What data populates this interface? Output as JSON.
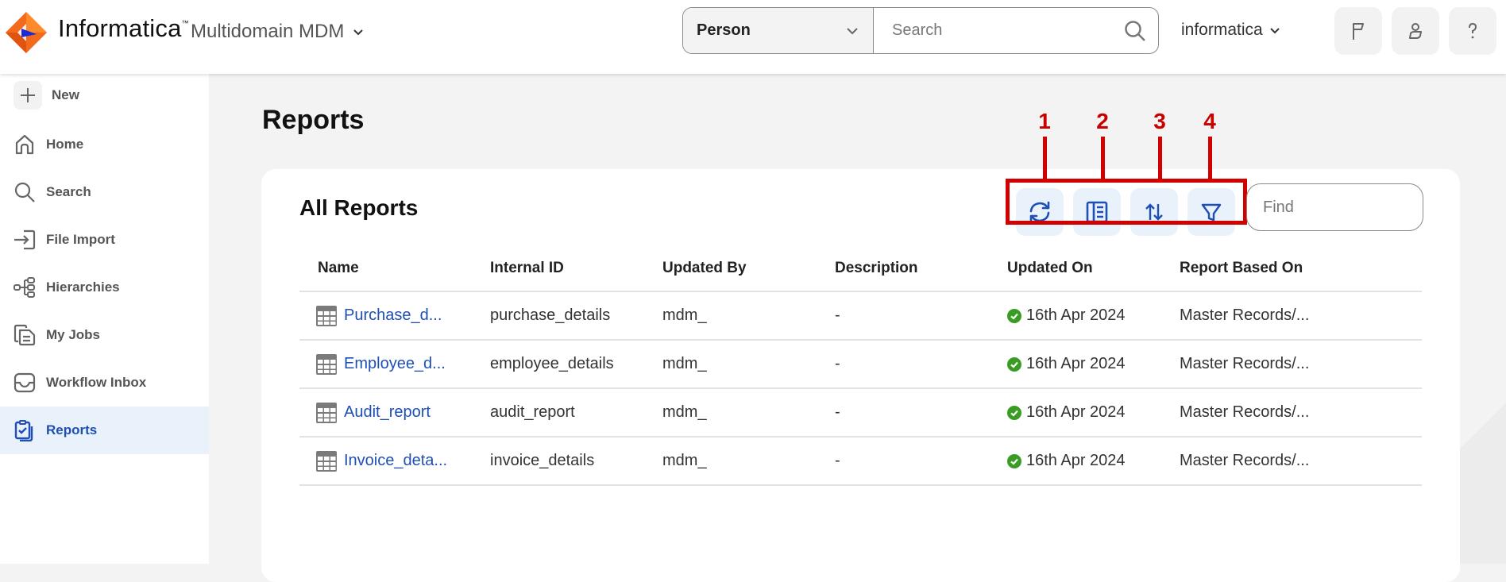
{
  "header": {
    "brand": "Informatica",
    "product": "Multidomain MDM",
    "entity_select": "Person",
    "search_placeholder": "Search",
    "user": "informatica",
    "icons": [
      "flag-icon",
      "user-icon",
      "help-icon"
    ]
  },
  "sidebar": {
    "new_label": "New",
    "items": [
      {
        "label": "Home",
        "icon": "home-icon",
        "active": false
      },
      {
        "label": "Search",
        "icon": "search-icon",
        "active": false
      },
      {
        "label": "File Import",
        "icon": "file-import-icon",
        "active": false
      },
      {
        "label": "Hierarchies",
        "icon": "hierarchies-icon",
        "active": false
      },
      {
        "label": "My Jobs",
        "icon": "jobs-icon",
        "active": false
      },
      {
        "label": "Workflow Inbox",
        "icon": "inbox-icon",
        "active": false
      },
      {
        "label": "Reports",
        "icon": "reports-icon",
        "active": true
      }
    ]
  },
  "main": {
    "page_title": "Reports",
    "card_title": "All Reports",
    "toolbar": {
      "buttons": [
        {
          "icon": "refresh-icon",
          "annotation": "1"
        },
        {
          "icon": "columns-icon",
          "annotation": "2"
        },
        {
          "icon": "sort-icon",
          "annotation": "3"
        },
        {
          "icon": "filter-icon",
          "annotation": "4"
        }
      ],
      "find_placeholder": "Find"
    },
    "table": {
      "columns": [
        "Name",
        "Internal ID",
        "Updated By",
        "Description",
        "Updated On",
        "Report Based On"
      ],
      "rows": [
        {
          "name": "Purchase_d...",
          "internal_id": "purchase_details",
          "updated_by": "mdm_",
          "description": "-",
          "updated_on": "16th Apr 2024",
          "based_on": "Master Records/..."
        },
        {
          "name": "Employee_d...",
          "internal_id": "employee_details",
          "updated_by": "mdm_",
          "description": "-",
          "updated_on": "16th Apr 2024",
          "based_on": "Master Records/..."
        },
        {
          "name": "Audit_report",
          "internal_id": "audit_report",
          "updated_by": "mdm_",
          "description": "-",
          "updated_on": "16th Apr 2024",
          "based_on": "Master Records/..."
        },
        {
          "name": "Invoice_deta...",
          "internal_id": "invoice_details",
          "updated_by": "mdm_",
          "description": "-",
          "updated_on": "16th Apr 2024",
          "based_on": "Master Records/..."
        }
      ]
    }
  },
  "colors": {
    "accent": "#1e4fb5",
    "active_bg": "#e9f1fb",
    "annotation": "#d30000",
    "success": "#3a9d23"
  }
}
